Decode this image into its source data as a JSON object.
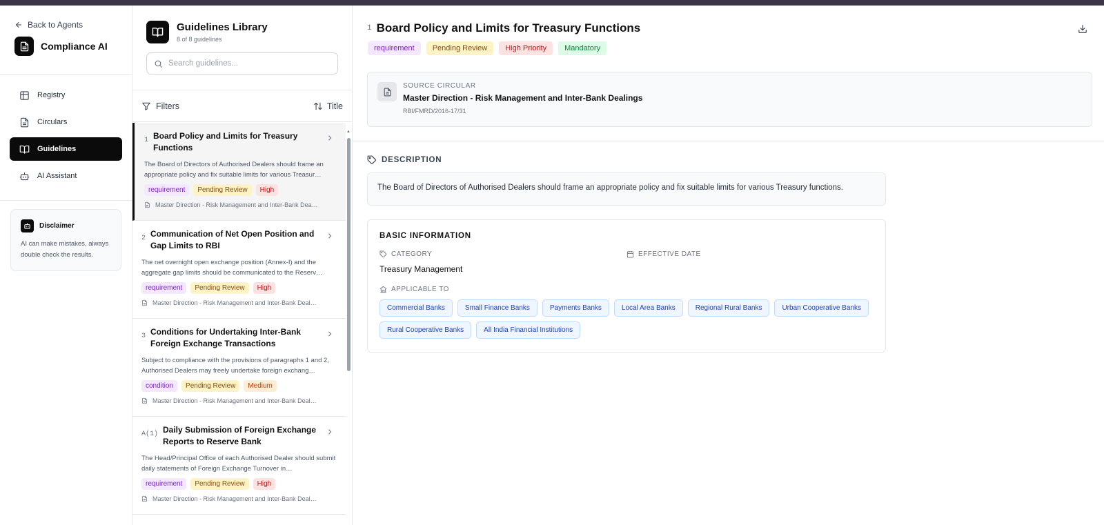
{
  "nav": {
    "back_label": "Back to Agents",
    "app_name": "Compliance AI",
    "items": [
      {
        "label": "Registry",
        "icon": "table-icon"
      },
      {
        "label": "Circulars",
        "icon": "document-icon"
      },
      {
        "label": "Guidelines",
        "icon": "book-open-icon",
        "active": true
      },
      {
        "label": "AI Assistant",
        "icon": "bot-icon"
      }
    ],
    "disclaimer": {
      "title": "Disclaimer",
      "text": "AI can make mistakes, always double check the results."
    }
  },
  "library": {
    "title": "Guidelines Library",
    "count": "8 of 8 guidelines",
    "search_placeholder": "Search guidelines...",
    "filters_label": "Filters",
    "sort_label": "Title",
    "cards": [
      {
        "num": "1",
        "title": "Board Policy and Limits for Treasury Functions",
        "desc": "The Board of Directors of Authorised Dealers should frame an appropriate policy and fix suitable limits for various Treasur…",
        "tags": [
          "requirement",
          "Pending Review",
          "High"
        ],
        "source": "Master Direction - Risk Management and Inter-Bank Dea…"
      },
      {
        "num": "2",
        "title": "Communication of Net Open Position and Gap Limits to RBI",
        "desc": "The net overnight open exchange position (Annex-I) and the aggregate gap limits should be communicated to the Reserv…",
        "tags": [
          "requirement",
          "Pending Review",
          "High"
        ],
        "source": "Master Direction - Risk Management and Inter-Bank Deal…"
      },
      {
        "num": "3",
        "title": "Conditions for Undertaking Inter-Bank Foreign Exchange Transactions",
        "desc": "Subject to compliance with the provisions of paragraphs 1 and 2, Authorised Dealers may freely undertake foreign exchang…",
        "tags": [
          "condition",
          "Pending Review",
          "Medium"
        ],
        "source": "Master Direction - Risk Management and Inter-Bank Deal…"
      },
      {
        "num": "A(1)",
        "title": "Daily Submission of Foreign Exchange Reports to Reserve Bank",
        "desc": "The Head/Principal Office of each Authorised Dealer should submit daily statements of Foreign Exchange Turnover in…",
        "tags": [
          "requirement",
          "Pending Review",
          "High"
        ],
        "source": "Master Direction - Risk Management and Inter-Bank Deal…"
      }
    ]
  },
  "detail": {
    "num": "1",
    "title": "Board Policy and Limits for Treasury Functions",
    "tags": [
      "requirement",
      "Pending Review",
      "High Priority",
      "Mandatory"
    ],
    "source_label": "SOURCE CIRCULAR",
    "source_title": "Master Direction - Risk Management and Inter-Bank Dealings",
    "source_ref": "RBI/FMRD/2016-17/31",
    "description_label": "DESCRIPTION",
    "description": "The Board of Directors of Authorised Dealers should frame an appropriate policy and fix suitable limits for various Treasury functions.",
    "basic_info_label": "BASIC INFORMATION",
    "category_label": "CATEGORY",
    "category": "Treasury Management",
    "effective_date_label": "EFFECTIVE DATE",
    "applicable_label": "APPLICABLE TO",
    "applicable": [
      "Commercial Banks",
      "Small Finance Banks",
      "Payments Banks",
      "Local Area Banks",
      "Regional Rural Banks",
      "Urban Cooperative Banks",
      "Rural Cooperative Banks",
      "All India Financial Institutions"
    ]
  },
  "colors": {
    "active_nav": "#0b0b0b",
    "tag_requirement": "#f3e8ff",
    "tag_pending": "#fef3c7",
    "tag_high": "#fde2e2",
    "tag_medium": "#ffedd5",
    "tag_mandatory": "#dcfce7",
    "chip": "#eff6ff"
  }
}
